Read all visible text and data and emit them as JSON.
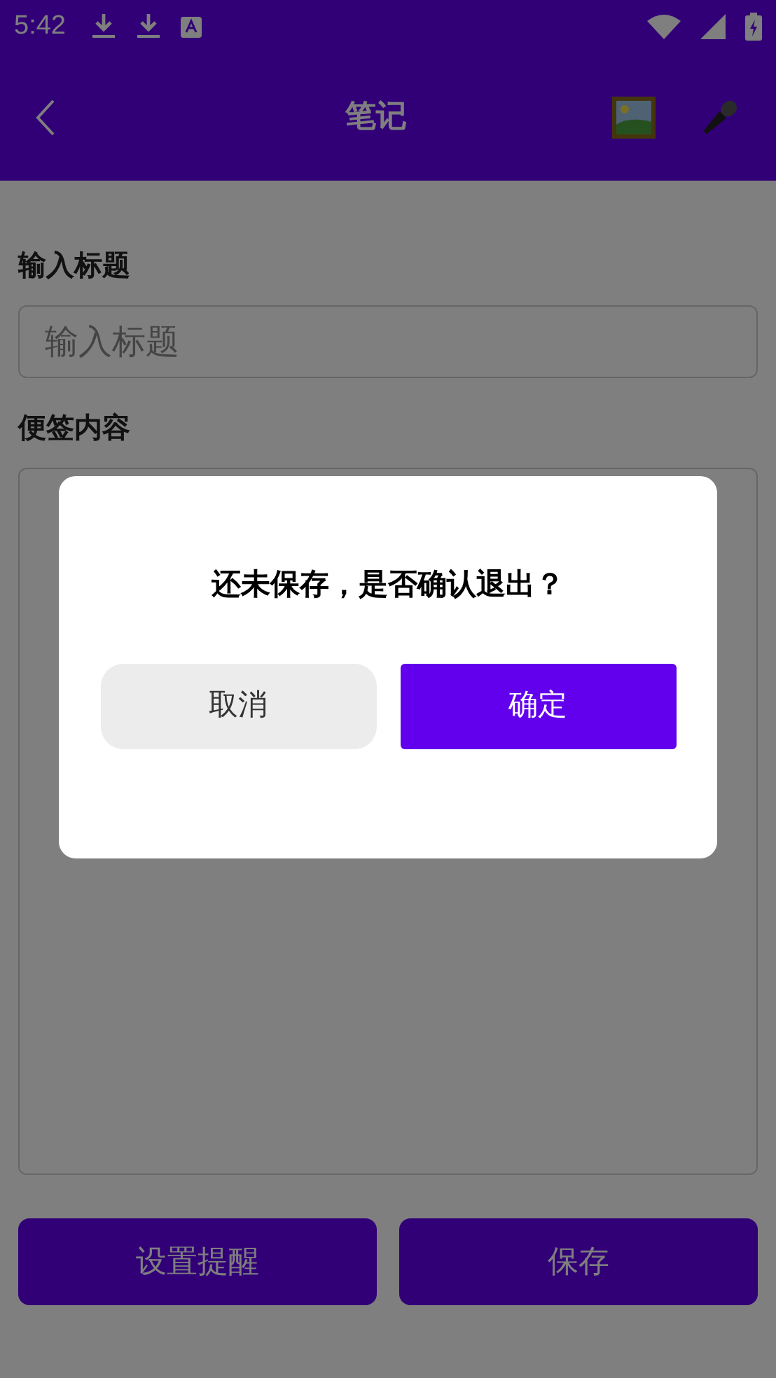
{
  "status_bar": {
    "time": "5:42"
  },
  "app_bar": {
    "title": "笔记"
  },
  "title_field": {
    "label": "输入标题",
    "placeholder": "输入标题"
  },
  "content_field": {
    "label": "便签内容"
  },
  "buttons": [
    "设置提醒",
    "保存"
  ],
  "dialog": {
    "message": "还未保存，是否确认退出？",
    "buttons": [
      {
        "label": "取消",
        "kind": "secondary"
      },
      {
        "label": "确定",
        "kind": "primary"
      }
    ]
  }
}
